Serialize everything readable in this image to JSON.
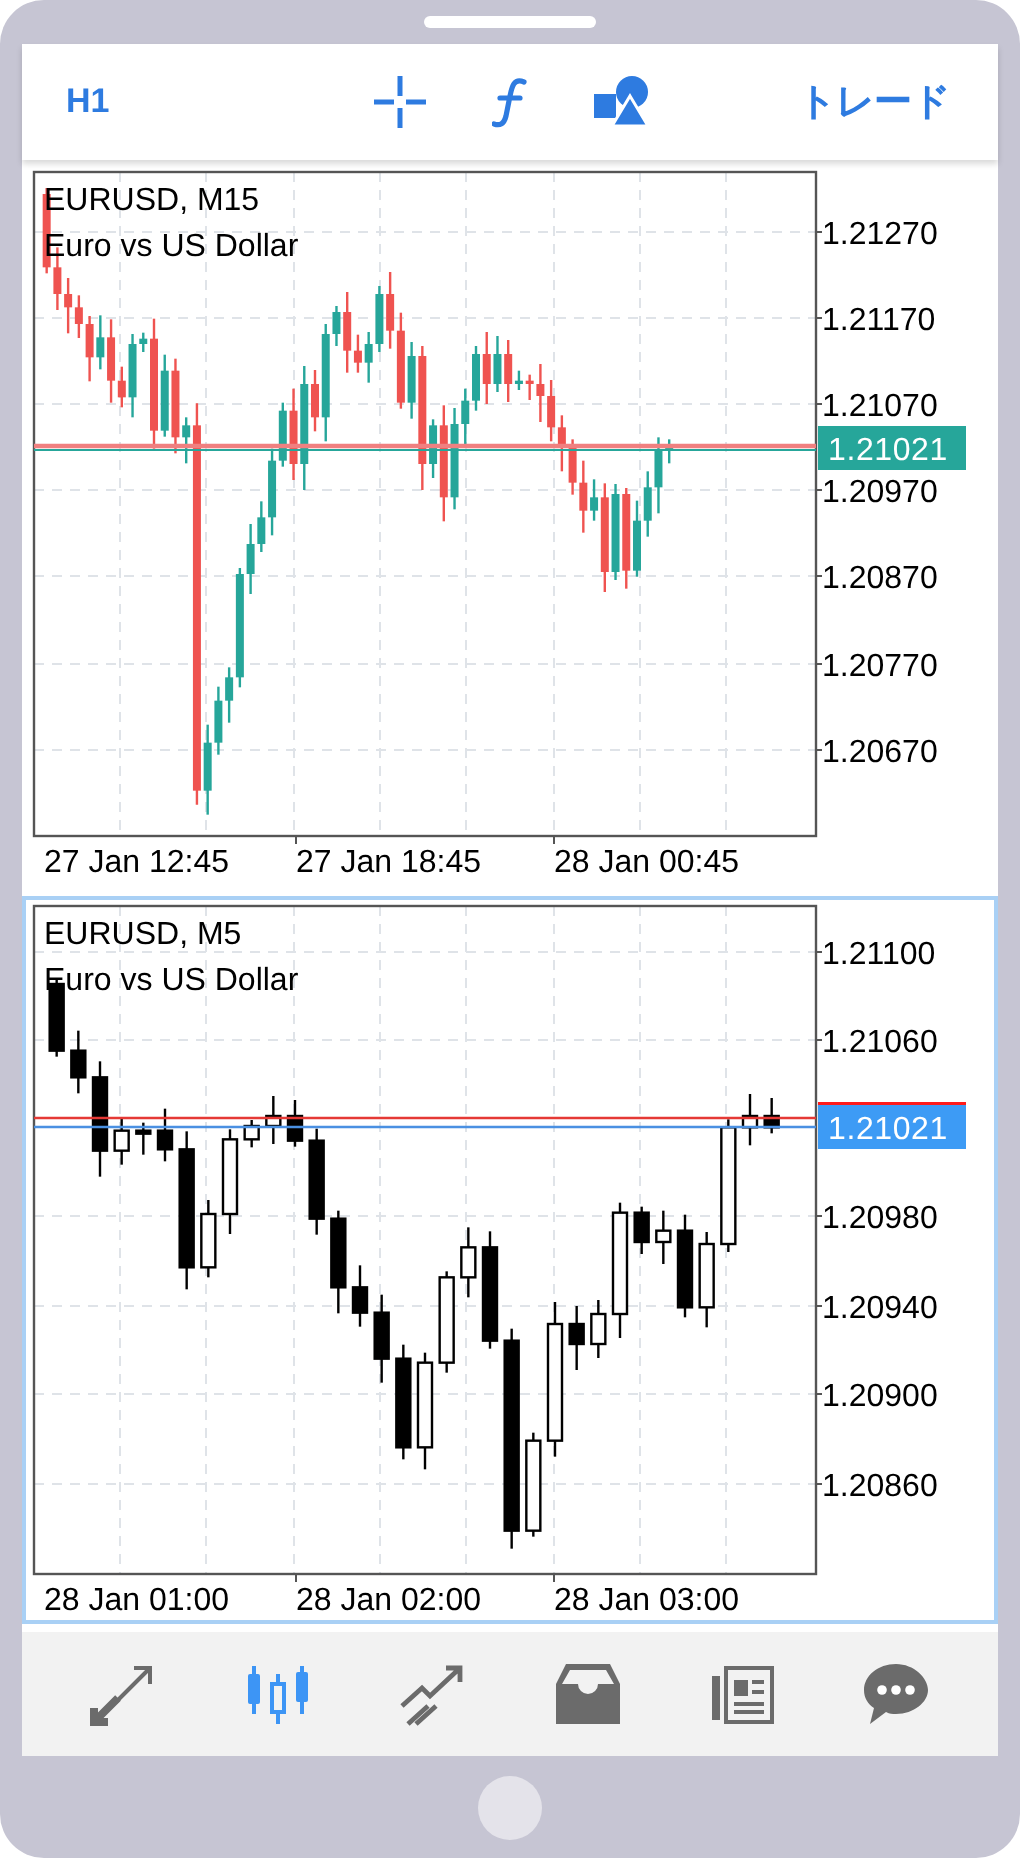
{
  "toolbar": {
    "timeframe": "H1",
    "trade": "トレード"
  },
  "charts": [
    {
      "kind": "colored",
      "selected": false,
      "symbol": "EURUSD, M15",
      "description": "Euro vs US Dollar",
      "yticks": [
        "1.21270",
        "1.21170",
        "1.21070",
        "1.20970",
        "1.20870",
        "1.20770",
        "1.20670"
      ],
      "xticks": [
        "27 Jan 12:45",
        "27 Jan 18:45",
        "28 Jan 00:45"
      ],
      "bid": "1.21021"
    },
    {
      "kind": "monochrome",
      "selected": true,
      "symbol": "EURUSD, M5",
      "description": "Euro vs US Dollar",
      "yticks": [
        "1.21100",
        "1.21060",
        "1.20980",
        "1.20940",
        "1.20900",
        "1.20860"
      ],
      "xticks": [
        "28 Jan 01:00",
        "28 Jan 02:00",
        "28 Jan 03:00"
      ],
      "bid": "1.21021"
    }
  ],
  "nav": [
    {
      "kind": "quotes",
      "selected": false
    },
    {
      "kind": "chart",
      "selected": true
    },
    {
      "kind": "trade",
      "selected": false
    },
    {
      "kind": "history",
      "selected": false
    },
    {
      "kind": "news",
      "selected": false
    },
    {
      "kind": "chat",
      "selected": false
    }
  ]
}
